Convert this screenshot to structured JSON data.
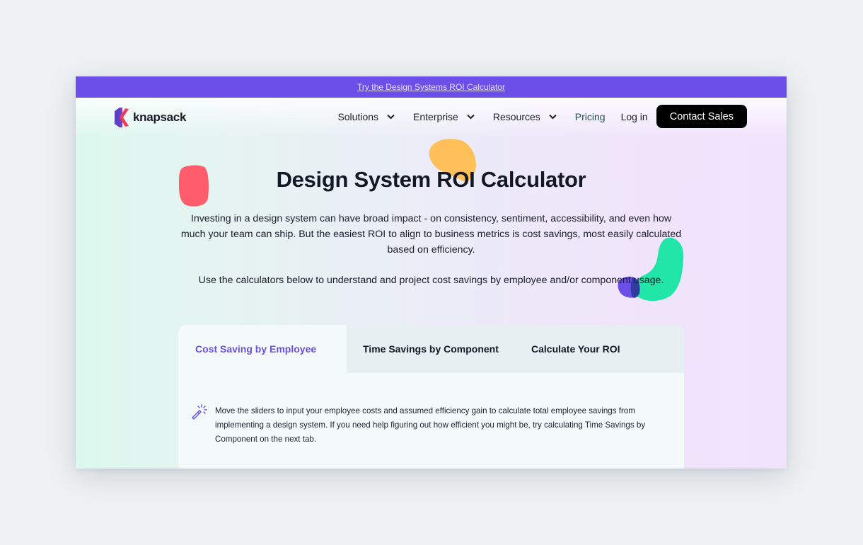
{
  "announcement": {
    "link_text": "Try the Design Systems ROI Calculator"
  },
  "brand": {
    "name": "knapsack",
    "logo_icon": "knapsack-logo-icon"
  },
  "nav": {
    "items": [
      {
        "label": "Solutions",
        "has_dropdown": true
      },
      {
        "label": "Enterprise",
        "has_dropdown": true
      },
      {
        "label": "Resources",
        "has_dropdown": true
      },
      {
        "label": "Pricing",
        "has_dropdown": false
      },
      {
        "label": "Log in",
        "has_dropdown": false
      }
    ],
    "cta_label": "Contact Sales"
  },
  "hero": {
    "title": "Design System ROI Calculator",
    "description": "Investing in a design system can have broad impact - on consistency, sentiment, accessibility, and even how much your team can ship. But the easiest ROI to align to business metrics is cost savings, most easily calculated based on efficiency.",
    "description2": "Use the calculators below to understand and project cost savings by employee and/or component usage."
  },
  "calculator": {
    "tabs": [
      {
        "label": "Cost Saving by Employee",
        "active": true
      },
      {
        "label": "Time Savings by Component",
        "active": false
      },
      {
        "label": "Calculate Your ROI",
        "active": false
      }
    ],
    "info_icon": "magic-wand-icon",
    "info_text": "Move the sliders to input your employee costs and assumed efficiency gain to calculate total employee savings from implementing a design system. If you need help figuring out how efficient you might be, try calculating Time Savings by Component on the next tab."
  },
  "colors": {
    "brand_purple": "#6c4fe8",
    "active_tab": "#6a4fe0",
    "pricing_link": "#1d4f4b",
    "blob_red": "#ff5c6c",
    "blob_yellow": "#ffc05a",
    "blob_green": "#22e6a8",
    "blob_purple": "#6a4ee8"
  }
}
